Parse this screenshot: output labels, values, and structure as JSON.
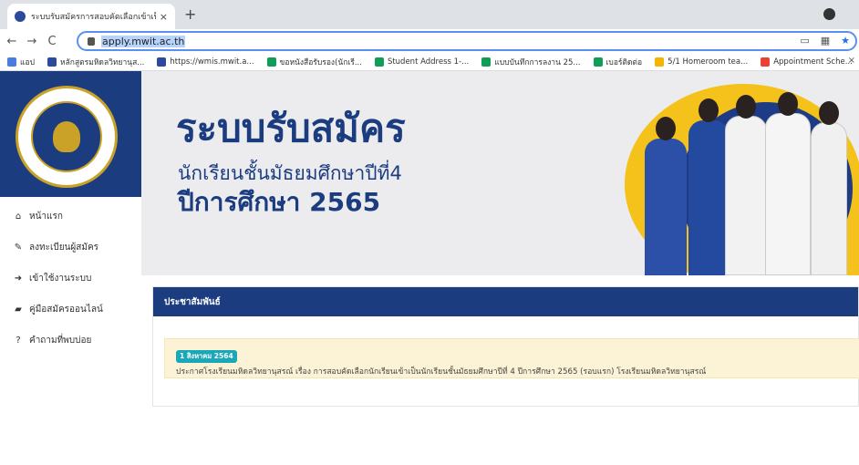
{
  "browser": {
    "tab_title": "ระบบรับสมัครการสอบคัดเลือกเข้าเป็นนั",
    "tab_close": "×",
    "new_tab": "+",
    "url": "apply.mwit.ac.th",
    "back": "←",
    "forward": "→",
    "reload": "C",
    "bookmarks": [
      {
        "label": "แอป",
        "color": "#4a7de0"
      },
      {
        "label": "หลักสูตรมหิดลวิทยานุส...",
        "color": "#2b4a9b"
      },
      {
        "label": "https://wmis.mwit.a...",
        "color": "#2b4a9b"
      },
      {
        "label": "ขอหนังสือรับรอง(นักเรี...",
        "color": "#0f9d58"
      },
      {
        "label": "Student Address 1-...",
        "color": "#0f9d58"
      },
      {
        "label": "แบบบันทึกการลงาน 25...",
        "color": "#0f9d58"
      },
      {
        "label": "เบอร์ติดต่อ",
        "color": "#0f9d58"
      },
      {
        "label": "5/1 Homeroom tea...",
        "color": "#f4b400"
      },
      {
        "label": "Appointment Sche...",
        "color": "#e94235"
      }
    ],
    "bookmark_close": "×"
  },
  "sidebar": {
    "menu": [
      {
        "icon": "home-icon",
        "glyph": "⌂",
        "label": "หน้าแรก"
      },
      {
        "icon": "pencil-icon",
        "glyph": "✎",
        "label": "ลงทะเบียนผู้สมัคร"
      },
      {
        "icon": "sign-in-icon",
        "glyph": "➜",
        "label": "เข้าใช้งานระบบ"
      },
      {
        "icon": "book-icon",
        "glyph": "▰",
        "label": "คู่มือสมัครออนไลน์"
      },
      {
        "icon": "question-circle-icon",
        "glyph": "?",
        "label": "คำถามที่พบบ่อย"
      }
    ]
  },
  "banner": {
    "title": "ระบบรับสมัคร",
    "subtitle1": "นักเรียนชั้นมัธยมศึกษาปีที่4",
    "subtitle2": "ปีการศึกษา 2565"
  },
  "news": {
    "heading": "ประชาสัมพันธ์",
    "badge": "1 สิงหาคม 2564",
    "text": "ประกาศโรงเรียนมหิดลวิทยานุสรณ์ เรื่อง การสอบคัดเลือกนักเรียนเข้าเป็นนักเรียนชั้นมัธยมศึกษาปีที่ 4 ปีการศึกษา 2565 (รอบแรก) โรงเรียนมหิดลวิทยานุสรณ์"
  },
  "colors": {
    "primary": "#1c3c80",
    "accent_yellow": "#f4c21a",
    "badge": "#1aa7b8",
    "alert_bg": "#fcf3d6"
  }
}
